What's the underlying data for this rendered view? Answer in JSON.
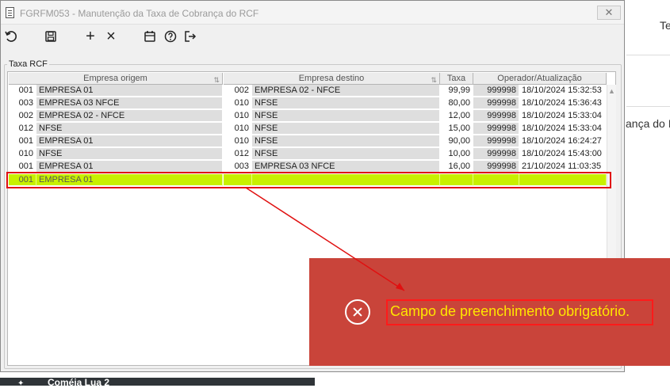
{
  "background": {
    "tab_text": "Te",
    "content_text": "ança do I",
    "bottom_text": "Coméia Lua 2"
  },
  "window": {
    "title": "FGRFM053 - Manutenção da Taxa de Cobrança do RCF",
    "close_label": "✕"
  },
  "toolbar": {
    "undo": "undo-icon",
    "save": "save-icon",
    "add": "+",
    "delete": "×",
    "calendar": "calendar-icon",
    "help": "help-icon",
    "exit": "exit-icon"
  },
  "group": {
    "label": "Taxa RCF"
  },
  "grid": {
    "columns": [
      "Empresa origem",
      "Empresa destino",
      "Taxa",
      "Operador/Atualização"
    ],
    "rows": [
      {
        "orig_code": "001",
        "orig_name": "EMPRESA 01",
        "dest_code": "002",
        "dest_name": "EMPRESA 02 - NFCE",
        "taxa": "99,99",
        "operador": "999998",
        "data": "18/10/2024 15:32:53"
      },
      {
        "orig_code": "003",
        "orig_name": "EMPRESA 03 NFCE",
        "dest_code": "010",
        "dest_name": "NFSE",
        "taxa": "80,00",
        "operador": "999998",
        "data": "18/10/2024 15:36:43"
      },
      {
        "orig_code": "002",
        "orig_name": "EMPRESA 02 - NFCE",
        "dest_code": "010",
        "dest_name": "NFSE",
        "taxa": "12,00",
        "operador": "999998",
        "data": "18/10/2024 15:33:04"
      },
      {
        "orig_code": "012",
        "orig_name": "NFSE",
        "dest_code": "010",
        "dest_name": "NFSE",
        "taxa": "15,00",
        "operador": "999998",
        "data": "18/10/2024 15:33:04"
      },
      {
        "orig_code": "001",
        "orig_name": "EMPRESA 01",
        "dest_code": "010",
        "dest_name": "NFSE",
        "taxa": "90,00",
        "operador": "999998",
        "data": "18/10/2024 16:24:27"
      },
      {
        "orig_code": "010",
        "orig_name": "NFSE",
        "dest_code": "012",
        "dest_name": "NFSE",
        "taxa": "10,00",
        "operador": "999998",
        "data": "18/10/2024 15:43:00"
      },
      {
        "orig_code": "001",
        "orig_name": "EMPRESA 01",
        "dest_code": "003",
        "dest_name": "EMPRESA 03 NFCE",
        "taxa": "16,00",
        "operador": "999998",
        "data": "21/10/2024 11:03:35"
      }
    ],
    "selected_row": {
      "orig_code": "001",
      "orig_name": "EMPRESA 01"
    }
  },
  "error": {
    "message": "Campo de preenchimento obrigatório.",
    "icon": "error-circle-x-icon"
  },
  "colors": {
    "selected_row": "#c8f000",
    "toast_bg": "#c9443a",
    "toast_text": "#ffe600",
    "highlight_red": "#e01010"
  }
}
